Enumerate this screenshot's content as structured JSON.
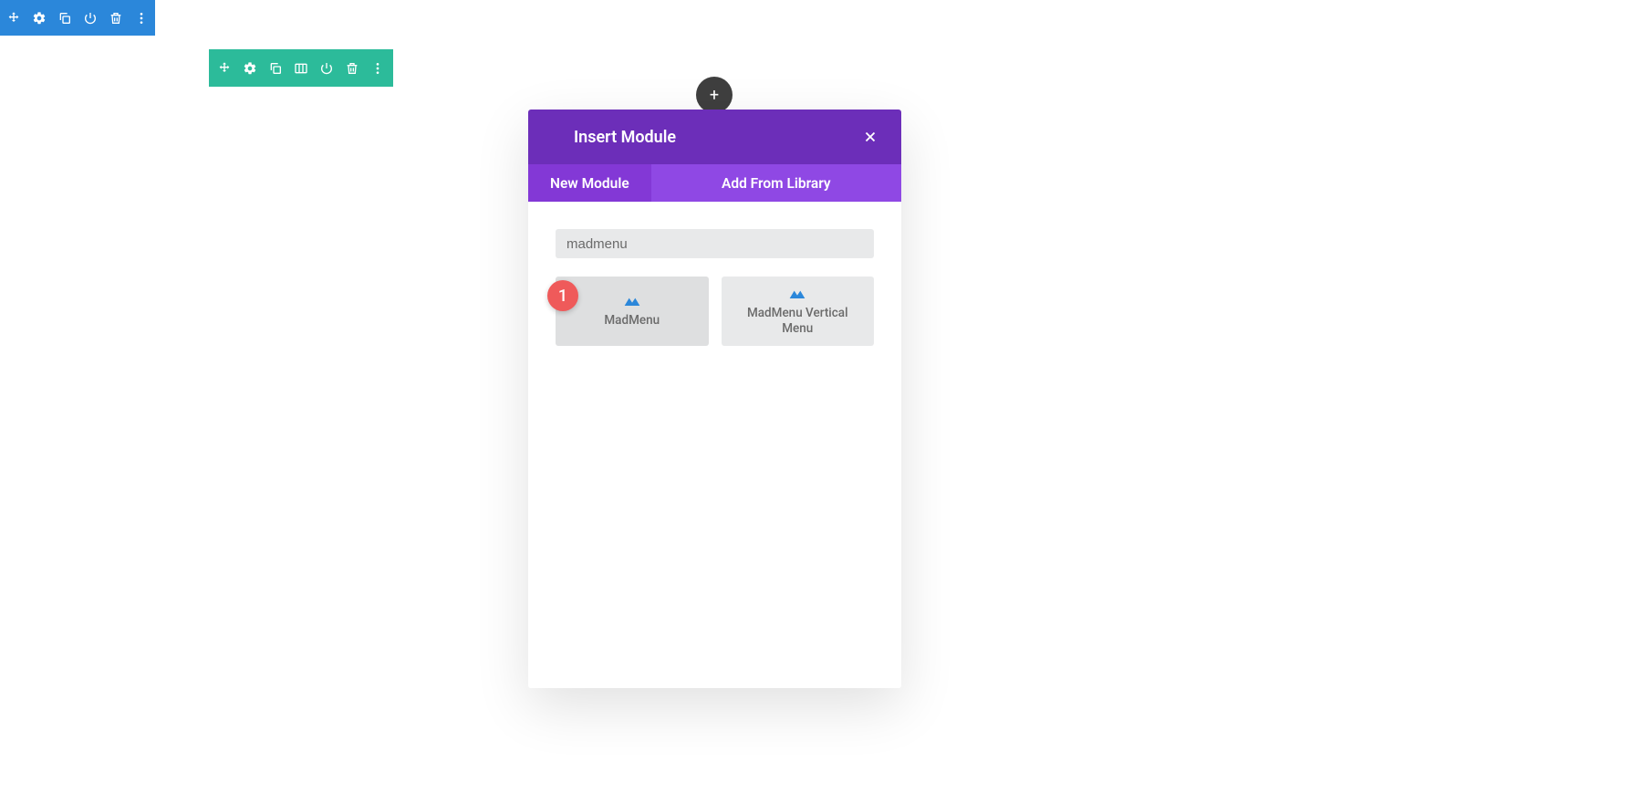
{
  "annotation": {
    "badge": "1"
  },
  "addButton": {
    "label": "+"
  },
  "modal": {
    "title": "Insert Module",
    "tabs": {
      "new_module": "New Module",
      "add_from_library": "Add From Library"
    },
    "search_value": "madmenu",
    "modules": [
      {
        "label": "MadMenu"
      },
      {
        "label": "MadMenu Vertical Menu"
      }
    ]
  }
}
